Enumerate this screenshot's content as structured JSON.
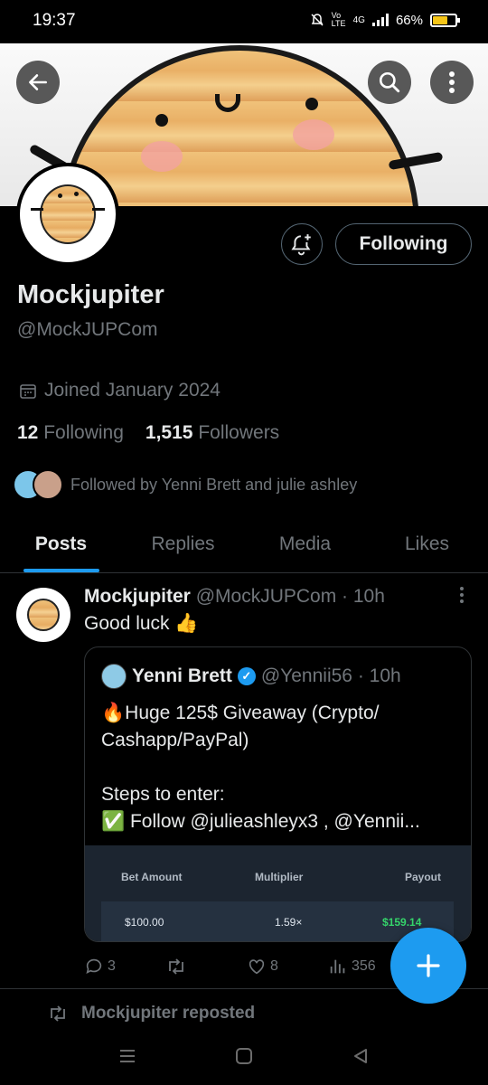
{
  "status_bar": {
    "time": "19:37",
    "network": "4G",
    "volte": "Vo LTE",
    "battery": "66%",
    "battery_level": 0.66
  },
  "profile": {
    "name": "Mockjupiter",
    "handle": "@MockJUPCom",
    "joined": "Joined January 2024",
    "following_count": "12",
    "following_label": "Following",
    "followers_count": "1,515",
    "followers_label": "Followers",
    "followed_by": "Followed by Yenni Brett and julie ashley",
    "follow_button": "Following"
  },
  "tabs": [
    {
      "label": "Posts",
      "active": true
    },
    {
      "label": "Replies",
      "active": false
    },
    {
      "label": "Media",
      "active": false
    },
    {
      "label": "Likes",
      "active": false
    }
  ],
  "post": {
    "author": "Mockjupiter",
    "handle_time": "@MockJUPCom · 10h",
    "text": "Good luck 👍",
    "quote": {
      "author": "Yenni Brett",
      "handle_time": "@Yennii56 · 10h",
      "line1": "🔥Huge 125$ Giveaway (Crypto/",
      "line2": "Cashapp/PayPal)",
      "line3": "Steps to enter:",
      "line4": "✅ Follow @julieashleyx3 , @Yennii...",
      "table": {
        "headers": [
          "Bet Amount",
          "Multiplier",
          "Payout"
        ],
        "row": [
          "$100.00",
          "1.59×",
          "$159.14"
        ]
      }
    },
    "replies": "3",
    "reposts": "",
    "likes": "8",
    "views": "356"
  },
  "repost_banner": "Mockjupiter reposted",
  "colors": {
    "accent": "#1d9bf0",
    "payout": "#35d46a",
    "muted": "#71767b"
  }
}
